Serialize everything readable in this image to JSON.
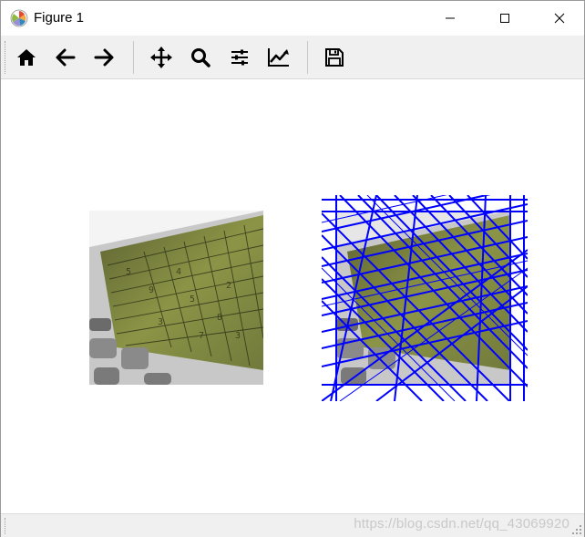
{
  "window": {
    "title": "Figure 1",
    "controls": [
      "minimize",
      "maximize",
      "close"
    ]
  },
  "toolbar": {
    "buttons": [
      {
        "name": "home-icon",
        "tooltip": "Home"
      },
      {
        "name": "back-arrow-icon",
        "tooltip": "Back"
      },
      {
        "name": "forward-arrow-icon",
        "tooltip": "Forward"
      },
      {
        "name": "pan-icon",
        "tooltip": "Pan"
      },
      {
        "name": "zoom-icon",
        "tooltip": "Zoom"
      },
      {
        "name": "subplots-icon",
        "tooltip": "Subplots"
      },
      {
        "name": "edit-axes-icon",
        "tooltip": "Customize"
      },
      {
        "name": "save-icon",
        "tooltip": "Save"
      }
    ]
  },
  "figure": {
    "subplots": [
      {
        "content": "sudoku-calculator-photo"
      },
      {
        "content": "sudoku-calculator-photo-with-hough-lines",
        "overlay_color": "#0000ff"
      }
    ]
  },
  "statusbar": {
    "watermark": "https://blog.csdn.net/qq_43069920"
  },
  "colors": {
    "toolbar_bg": "#f0f0f0",
    "line_color": "#0000ff"
  }
}
